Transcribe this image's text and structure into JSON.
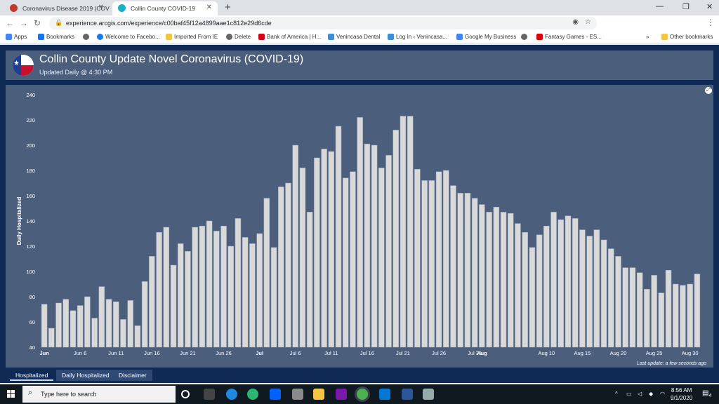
{
  "browser": {
    "tabs": [
      {
        "title": "Coronavirus Disease 2019 (COVID",
        "active": false
      },
      {
        "title": "Collin County COVID-19",
        "active": true
      }
    ],
    "url": "experience.arcgis.com/experience/c00baf45f12a4899aae1c812e29d6cde",
    "bookmarks": [
      "Apps",
      "Bookmarks",
      "Welcome to Facebo...",
      "Imported From IE",
      "Delete",
      "Bank of America | H...",
      "Venincasa Dental",
      "Log In ‹ Venincasa...",
      "Google My Business",
      "Fantasy Games - ES..."
    ],
    "other_bookmarks": "Other bookmarks"
  },
  "header": {
    "title": "Collin County Update Novel Coronavirus (COVID-19)",
    "subtitle": "Updated Daily @ 4:30 PM"
  },
  "chart_footer": {
    "last_update": "Last update: a few seconds ago"
  },
  "bottom_tabs": [
    "Hospitalized",
    "Daily Hospitalized",
    "Disclaimer"
  ],
  "taskbar": {
    "search_placeholder": "Type here to search",
    "time": "8:56 AM",
    "date": "9/1/2020",
    "notifications": "4"
  },
  "colors": {
    "page_bg": "#0f2a55",
    "panel_bg": "#4b5f7d",
    "bar_fill": "#d9d9d9",
    "bar_stroke": "#9aa6b8"
  },
  "chart_data": {
    "type": "bar",
    "title": "",
    "xlabel": "",
    "ylabel": "Daily Hospitalized",
    "ylim": [
      40,
      240
    ],
    "yticks": [
      40,
      60,
      80,
      100,
      120,
      140,
      160,
      180,
      200,
      220,
      240
    ],
    "grid": false,
    "start_date": "2020-06-01",
    "categories": [
      "Jun 1",
      "Jun 2",
      "Jun 3",
      "Jun 4",
      "Jun 5",
      "Jun 6",
      "Jun 7",
      "Jun 8",
      "Jun 9",
      "Jun 10",
      "Jun 11",
      "Jun 12",
      "Jun 13",
      "Jun 14",
      "Jun 15",
      "Jun 16",
      "Jun 17",
      "Jun 18",
      "Jun 19",
      "Jun 20",
      "Jun 21",
      "Jun 22",
      "Jun 23",
      "Jun 24",
      "Jun 25",
      "Jun 26",
      "Jun 27",
      "Jun 28",
      "Jun 29",
      "Jun 30",
      "Jul 1",
      "Jul 2",
      "Jul 3",
      "Jul 4",
      "Jul 5",
      "Jul 6",
      "Jul 7",
      "Jul 8",
      "Jul 9",
      "Jul 10",
      "Jul 11",
      "Jul 12",
      "Jul 13",
      "Jul 14",
      "Jul 15",
      "Jul 16",
      "Jul 17",
      "Jul 18",
      "Jul 19",
      "Jul 20",
      "Jul 21",
      "Jul 22",
      "Jul 23",
      "Jul 24",
      "Jul 25",
      "Jul 26",
      "Jul 27",
      "Jul 28",
      "Jul 29",
      "Jul 30",
      "Jul 31",
      "Aug 1",
      "Aug 2",
      "Aug 3",
      "Aug 4",
      "Aug 5",
      "Aug 6",
      "Aug 7",
      "Aug 8",
      "Aug 9",
      "Aug 10",
      "Aug 11",
      "Aug 12",
      "Aug 13",
      "Aug 14",
      "Aug 15",
      "Aug 16",
      "Aug 17",
      "Aug 18",
      "Aug 19",
      "Aug 20",
      "Aug 21",
      "Aug 22",
      "Aug 23",
      "Aug 24",
      "Aug 25",
      "Aug 26",
      "Aug 27",
      "Aug 28",
      "Aug 29",
      "Aug 30",
      "Aug 31"
    ],
    "values": [
      74,
      55,
      75,
      78,
      69,
      73,
      80,
      63,
      88,
      78,
      76,
      62,
      77,
      57,
      92,
      112,
      131,
      135,
      105,
      122,
      116,
      135,
      136,
      140,
      132,
      136,
      120,
      142,
      127,
      122,
      130,
      158,
      119,
      167,
      170,
      200,
      182,
      147,
      190,
      197,
      195,
      215,
      174,
      179,
      222,
      201,
      200,
      182,
      192,
      212,
      223,
      223,
      181,
      172,
      172,
      179,
      180,
      168,
      162,
      162,
      158,
      153,
      147,
      151,
      147,
      146,
      138,
      131,
      119,
      129,
      136,
      147,
      141,
      144,
      142,
      133,
      128,
      133,
      125,
      118,
      112,
      103,
      103,
      99,
      86,
      97,
      83,
      101,
      90,
      89,
      90,
      98
    ],
    "xtick_labels": [
      "Jun",
      "Jun 6",
      "Jun 11",
      "Jun 16",
      "Jun 21",
      "Jun 26",
      "Jul",
      "Jul 6",
      "Jul 11",
      "Jul 16",
      "Jul 21",
      "Jul 26",
      "Jul 31",
      "Aug",
      "Aug 10",
      "Aug 15",
      "Aug 20",
      "Aug 25",
      "Aug 30"
    ]
  }
}
